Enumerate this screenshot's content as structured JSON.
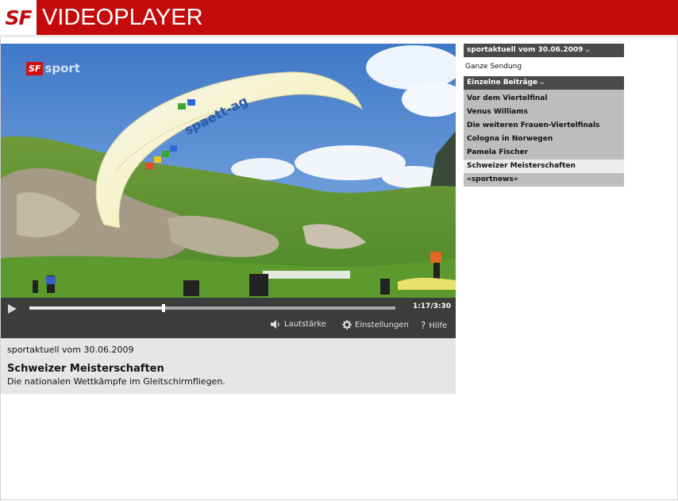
{
  "header": {
    "logo": "SF",
    "title": "VIDEOPLAYER",
    "brand_color": "#c40a0a"
  },
  "video": {
    "channel_logo": "SF",
    "channel_name": "sport",
    "glider_text": "spaett-ag"
  },
  "player": {
    "play_icon": "play-icon",
    "time": "1:17/3:30",
    "progress": 0.367,
    "buttons": {
      "volume": "Lautstärke",
      "settings": "Einstellungen",
      "help": "Hilfe"
    }
  },
  "info": {
    "show_date": "sportaktuell vom 30.06.2009",
    "clip_title": "Schweizer Meisterschaften",
    "clip_desc": "Die nationalen Wettkämpfe im Gleitschirmfliegen."
  },
  "sidebar": {
    "show_header": "sportaktuell vom 30.06.2009",
    "full_show": "Ganze Sendung",
    "segments_header": "Einzelne Beiträge",
    "items": [
      {
        "label": "Vor dem Viertelfinal",
        "active": false
      },
      {
        "label": "Venus Williams",
        "active": false
      },
      {
        "label": "Die weiteren Frauen-Viertelfinals",
        "active": false
      },
      {
        "label": "Cologna in Norwegen",
        "active": false
      },
      {
        "label": "Pamela Fischer",
        "active": false
      },
      {
        "label": "Schweizer Meisterschaften",
        "active": true
      },
      {
        "label": "«sportnews»",
        "active": false
      }
    ]
  }
}
